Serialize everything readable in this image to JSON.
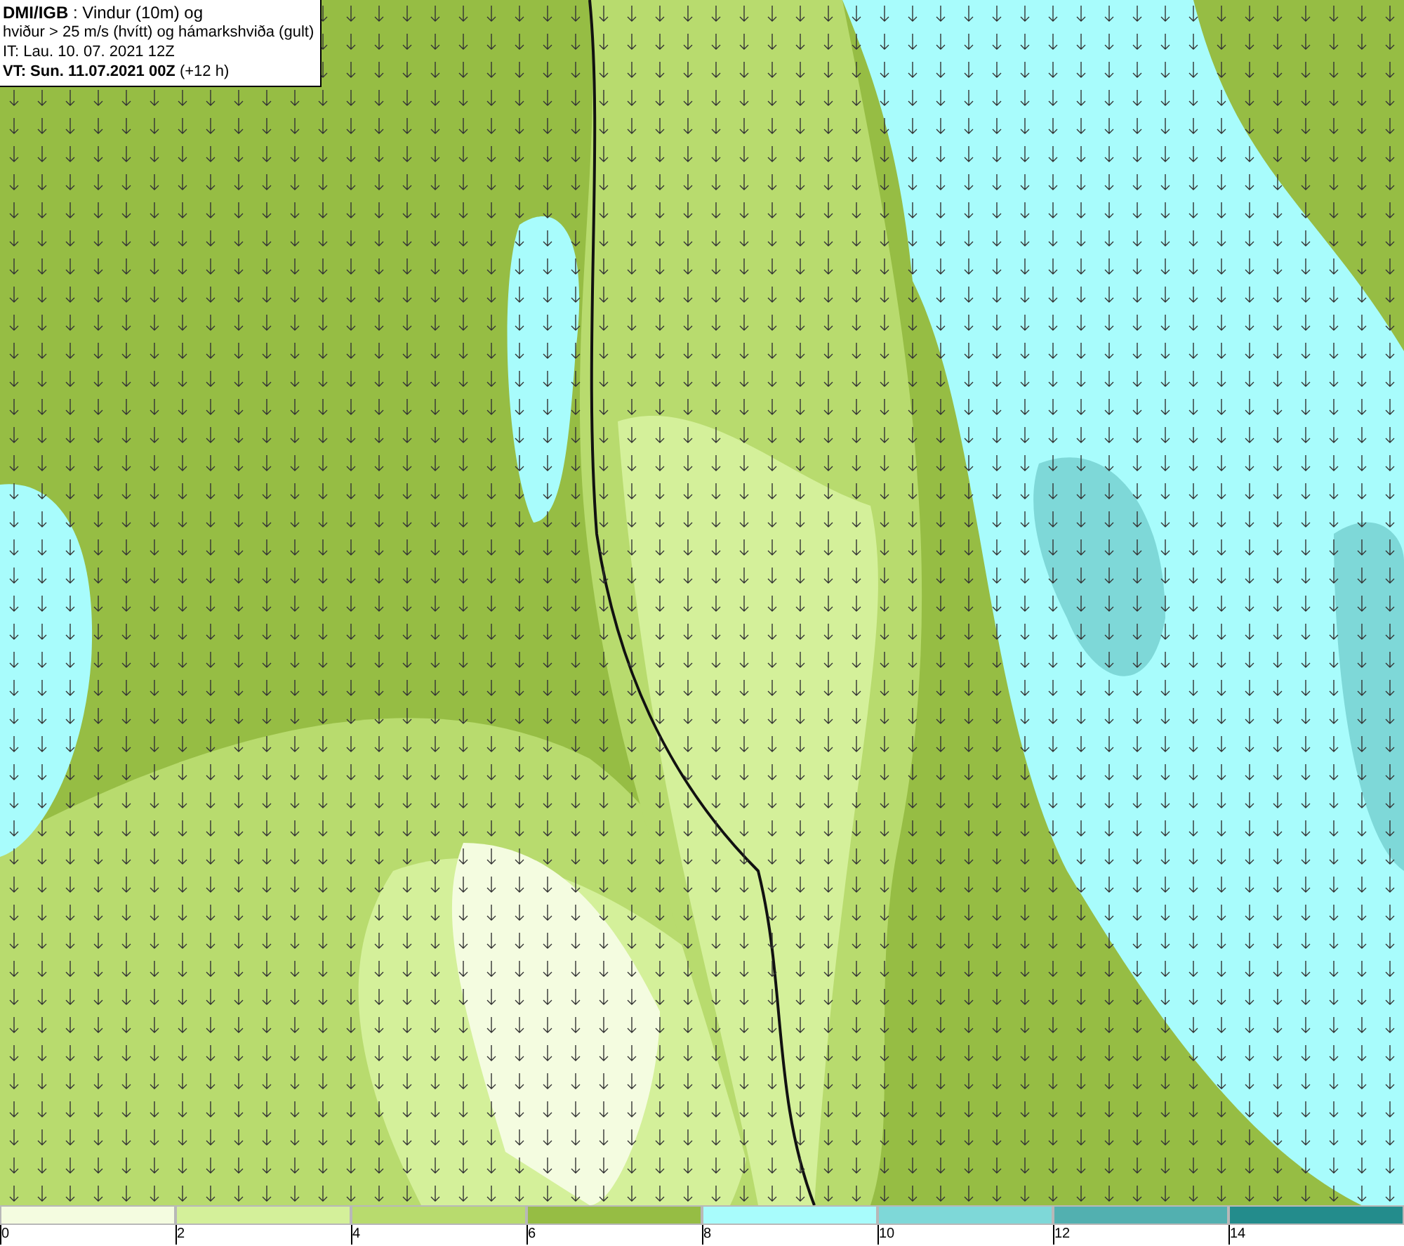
{
  "info_box": {
    "lines": [
      "**DMI/IGB** : Vindur (10m) og",
      "hviður > 25 m/s (hvítt) og hámarkshviða (gult)",
      "IT: Lau. 10. 07. 2021 12Z",
      "**VT: Sun. 11.07.2021 00Z** (+12 h)"
    ]
  },
  "legend": {
    "bins": [
      {
        "label": "0",
        "color": "#f4fce0"
      },
      {
        "label": "2",
        "color": "#d4f09a"
      },
      {
        "label": "4",
        "color": "#b8db6e"
      },
      {
        "label": "6",
        "color": "#96bd44"
      },
      {
        "label": "8",
        "color": "#a8fcfc"
      },
      {
        "label": "10",
        "color": "#7ed8d8"
      },
      {
        "label": "12",
        "color": "#52b0b0"
      },
      {
        "label": "14",
        "color": "#238c8c"
      }
    ]
  }
}
